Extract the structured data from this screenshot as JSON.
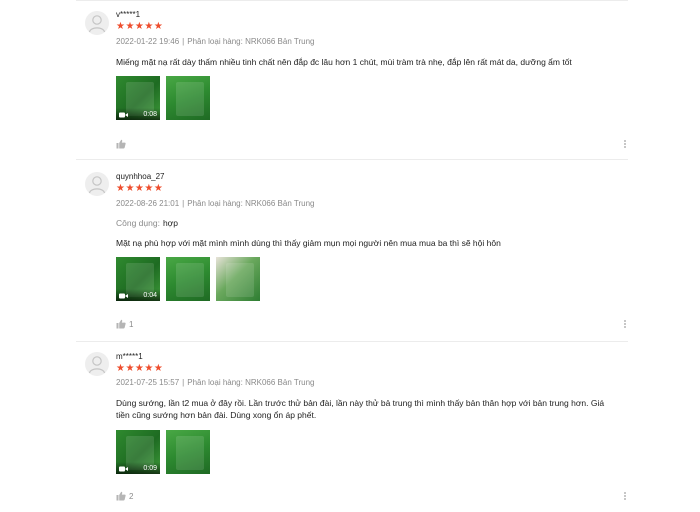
{
  "reviews": [
    {
      "username": "v*****1",
      "stars": "★★★★★",
      "date": "2022-01-22 19:46",
      "variant_label": "Phân loại hàng:",
      "variant": "NRK066 Bản Trung",
      "text": "Miếng mặt nạ rất dày thấm nhiều tinh chất nên đắp đc lâu hơn 1 chút, mùi tràm trà nhẹ, đắp lên rất mát da, dưỡng ẩm tốt",
      "video_duration": "0:08",
      "likes": "",
      "rating": 5
    },
    {
      "username": "quynhhoa_27",
      "stars": "★★★★★",
      "date": "2022-08-26 21:01",
      "variant_label": "Phân loại hàng:",
      "variant": "NRK066 Bản Trung",
      "attr_label": "Công dụng:",
      "attr_value": "hợp",
      "text": "Mặt nạ phù hợp với mặt mình mình dùng thì thấy giảm mụn mọi người nên mua mua ba thì sẽ hội hôn",
      "video_duration": "0:04",
      "likes": "1",
      "rating": 5
    },
    {
      "username": "m*****1",
      "stars": "★★★★★",
      "date": "2021-07-25 15:57",
      "variant_label": "Phân loại hàng:",
      "variant": "NRK066 Bản Trung",
      "text": "Dùng sướng, lần t2 mua ở đây rồi. Lần trước thử bản đài, lần này thử bả trung thì mình thấy bản thân hợp với bản trung hơn. Giá tiền cũng sướng hơn bản đài. Dùng xong ổn áp phết.",
      "video_duration": "0:09",
      "likes": "2",
      "rating": 5
    }
  ],
  "colors": {
    "star": "#ee4d2d",
    "meta": "#8a8a8a",
    "divider": "#ececec"
  }
}
